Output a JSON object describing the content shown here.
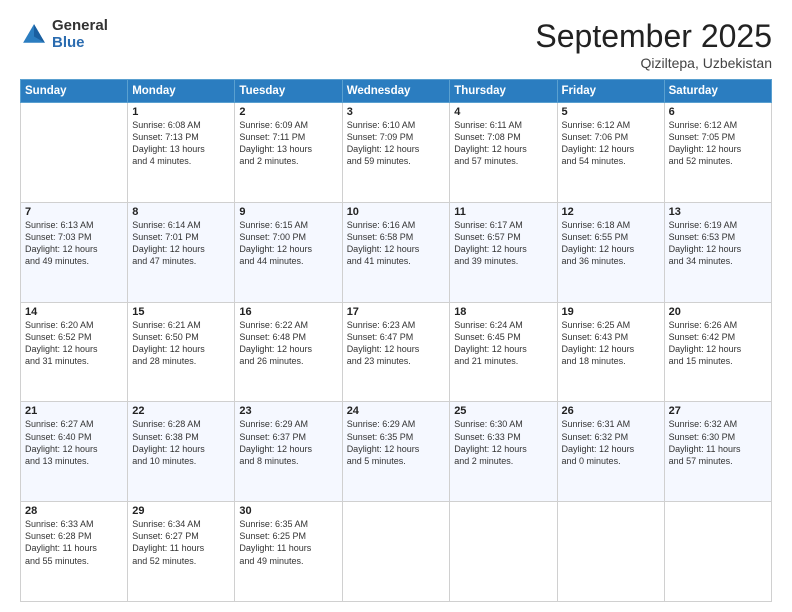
{
  "header": {
    "logo_general": "General",
    "logo_blue": "Blue",
    "month_title": "September 2025",
    "location": "Qiziltepa, Uzbekistan"
  },
  "weekdays": [
    "Sunday",
    "Monday",
    "Tuesday",
    "Wednesday",
    "Thursday",
    "Friday",
    "Saturday"
  ],
  "weeks": [
    [
      {
        "day": "",
        "info": ""
      },
      {
        "day": "1",
        "info": "Sunrise: 6:08 AM\nSunset: 7:13 PM\nDaylight: 13 hours\nand 4 minutes."
      },
      {
        "day": "2",
        "info": "Sunrise: 6:09 AM\nSunset: 7:11 PM\nDaylight: 13 hours\nand 2 minutes."
      },
      {
        "day": "3",
        "info": "Sunrise: 6:10 AM\nSunset: 7:09 PM\nDaylight: 12 hours\nand 59 minutes."
      },
      {
        "day": "4",
        "info": "Sunrise: 6:11 AM\nSunset: 7:08 PM\nDaylight: 12 hours\nand 57 minutes."
      },
      {
        "day": "5",
        "info": "Sunrise: 6:12 AM\nSunset: 7:06 PM\nDaylight: 12 hours\nand 54 minutes."
      },
      {
        "day": "6",
        "info": "Sunrise: 6:12 AM\nSunset: 7:05 PM\nDaylight: 12 hours\nand 52 minutes."
      }
    ],
    [
      {
        "day": "7",
        "info": "Sunrise: 6:13 AM\nSunset: 7:03 PM\nDaylight: 12 hours\nand 49 minutes."
      },
      {
        "day": "8",
        "info": "Sunrise: 6:14 AM\nSunset: 7:01 PM\nDaylight: 12 hours\nand 47 minutes."
      },
      {
        "day": "9",
        "info": "Sunrise: 6:15 AM\nSunset: 7:00 PM\nDaylight: 12 hours\nand 44 minutes."
      },
      {
        "day": "10",
        "info": "Sunrise: 6:16 AM\nSunset: 6:58 PM\nDaylight: 12 hours\nand 41 minutes."
      },
      {
        "day": "11",
        "info": "Sunrise: 6:17 AM\nSunset: 6:57 PM\nDaylight: 12 hours\nand 39 minutes."
      },
      {
        "day": "12",
        "info": "Sunrise: 6:18 AM\nSunset: 6:55 PM\nDaylight: 12 hours\nand 36 minutes."
      },
      {
        "day": "13",
        "info": "Sunrise: 6:19 AM\nSunset: 6:53 PM\nDaylight: 12 hours\nand 34 minutes."
      }
    ],
    [
      {
        "day": "14",
        "info": "Sunrise: 6:20 AM\nSunset: 6:52 PM\nDaylight: 12 hours\nand 31 minutes."
      },
      {
        "day": "15",
        "info": "Sunrise: 6:21 AM\nSunset: 6:50 PM\nDaylight: 12 hours\nand 28 minutes."
      },
      {
        "day": "16",
        "info": "Sunrise: 6:22 AM\nSunset: 6:48 PM\nDaylight: 12 hours\nand 26 minutes."
      },
      {
        "day": "17",
        "info": "Sunrise: 6:23 AM\nSunset: 6:47 PM\nDaylight: 12 hours\nand 23 minutes."
      },
      {
        "day": "18",
        "info": "Sunrise: 6:24 AM\nSunset: 6:45 PM\nDaylight: 12 hours\nand 21 minutes."
      },
      {
        "day": "19",
        "info": "Sunrise: 6:25 AM\nSunset: 6:43 PM\nDaylight: 12 hours\nand 18 minutes."
      },
      {
        "day": "20",
        "info": "Sunrise: 6:26 AM\nSunset: 6:42 PM\nDaylight: 12 hours\nand 15 minutes."
      }
    ],
    [
      {
        "day": "21",
        "info": "Sunrise: 6:27 AM\nSunset: 6:40 PM\nDaylight: 12 hours\nand 13 minutes."
      },
      {
        "day": "22",
        "info": "Sunrise: 6:28 AM\nSunset: 6:38 PM\nDaylight: 12 hours\nand 10 minutes."
      },
      {
        "day": "23",
        "info": "Sunrise: 6:29 AM\nSunset: 6:37 PM\nDaylight: 12 hours\nand 8 minutes."
      },
      {
        "day": "24",
        "info": "Sunrise: 6:29 AM\nSunset: 6:35 PM\nDaylight: 12 hours\nand 5 minutes."
      },
      {
        "day": "25",
        "info": "Sunrise: 6:30 AM\nSunset: 6:33 PM\nDaylight: 12 hours\nand 2 minutes."
      },
      {
        "day": "26",
        "info": "Sunrise: 6:31 AM\nSunset: 6:32 PM\nDaylight: 12 hours\nand 0 minutes."
      },
      {
        "day": "27",
        "info": "Sunrise: 6:32 AM\nSunset: 6:30 PM\nDaylight: 11 hours\nand 57 minutes."
      }
    ],
    [
      {
        "day": "28",
        "info": "Sunrise: 6:33 AM\nSunset: 6:28 PM\nDaylight: 11 hours\nand 55 minutes."
      },
      {
        "day": "29",
        "info": "Sunrise: 6:34 AM\nSunset: 6:27 PM\nDaylight: 11 hours\nand 52 minutes."
      },
      {
        "day": "30",
        "info": "Sunrise: 6:35 AM\nSunset: 6:25 PM\nDaylight: 11 hours\nand 49 minutes."
      },
      {
        "day": "",
        "info": ""
      },
      {
        "day": "",
        "info": ""
      },
      {
        "day": "",
        "info": ""
      },
      {
        "day": "",
        "info": ""
      }
    ]
  ]
}
